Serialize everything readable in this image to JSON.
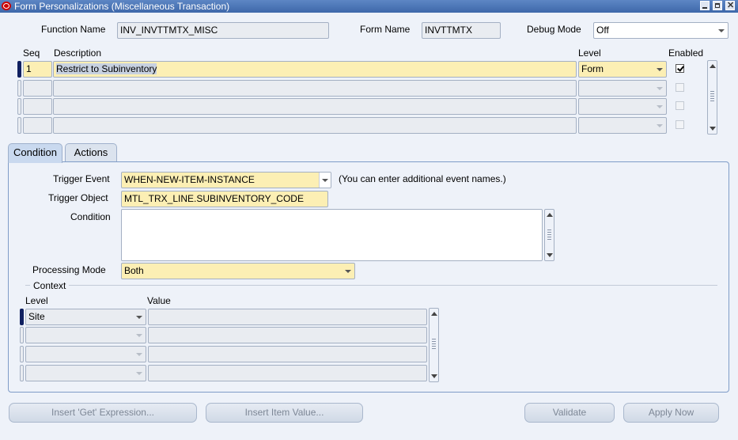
{
  "window": {
    "title": "Form Personalizations (Miscellaneous Transaction)"
  },
  "header": {
    "function_name_label": "Function Name",
    "function_name_value": "INV_INVTTMTX_MISC",
    "form_name_label": "Form Name",
    "form_name_value": "INVTTMTX",
    "debug_mode_label": "Debug Mode",
    "debug_mode_value": "Off"
  },
  "rules_table": {
    "columns": {
      "seq": "Seq",
      "description": "Description",
      "level": "Level",
      "enabled": "Enabled"
    },
    "rows": [
      {
        "seq": "1",
        "description": "Restrict to Subinventory",
        "level": "Form",
        "enabled": true
      },
      {
        "seq": "",
        "description": "",
        "level": "",
        "enabled": false
      },
      {
        "seq": "",
        "description": "",
        "level": "",
        "enabled": false
      },
      {
        "seq": "",
        "description": "",
        "level": "",
        "enabled": false
      }
    ]
  },
  "tabs": [
    {
      "label": "Condition",
      "active": true
    },
    {
      "label": "Actions",
      "active": false
    }
  ],
  "condition": {
    "trigger_event_label": "Trigger Event",
    "trigger_event_value": "WHEN-NEW-ITEM-INSTANCE",
    "trigger_event_hint": "(You can enter additional event names.)",
    "trigger_object_label": "Trigger Object",
    "trigger_object_value": "MTL_TRX_LINE.SUBINVENTORY_CODE",
    "condition_label": "Condition",
    "condition_value": "",
    "processing_mode_label": "Processing Mode",
    "processing_mode_value": "Both"
  },
  "context": {
    "section_label": "Context",
    "columns": {
      "level": "Level",
      "value": "Value"
    },
    "rows": [
      {
        "level": "Site",
        "value": ""
      },
      {
        "level": "",
        "value": ""
      },
      {
        "level": "",
        "value": ""
      },
      {
        "level": "",
        "value": ""
      }
    ]
  },
  "buttons": {
    "insert_get": "Insert 'Get' Expression...",
    "insert_item": "Insert Item Value...",
    "validate": "Validate",
    "apply_now": "Apply Now"
  },
  "colors": {
    "title_bar": "#4a74b6",
    "required_field": "#fcefb4",
    "background": "#eef2f9"
  }
}
